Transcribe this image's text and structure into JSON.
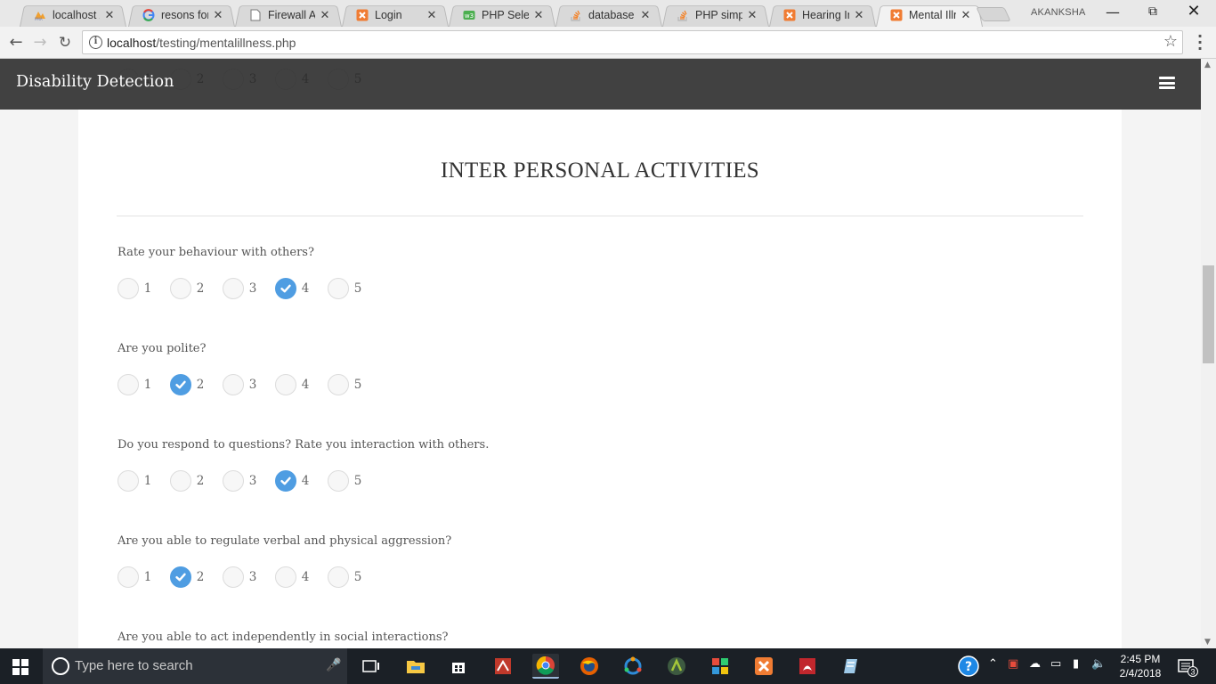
{
  "browser": {
    "tabs": [
      {
        "title": "localhost /",
        "icon": "phpmyadmin-icon",
        "color": "#e8a33d",
        "active": false
      },
      {
        "title": "resons for l",
        "icon": "google-icon",
        "color": "#4285f4",
        "active": false
      },
      {
        "title": "Firewall Aut",
        "icon": "document-icon",
        "color": "#777777",
        "active": false
      },
      {
        "title": "Login",
        "icon": "xampp-icon",
        "color": "#f07c33",
        "active": false
      },
      {
        "title": "PHP Select",
        "icon": "w3schools-icon",
        "color": "#4caf50",
        "active": false
      },
      {
        "title": "database -",
        "icon": "stackoverflow-icon",
        "color": "#f48024",
        "active": false
      },
      {
        "title": "PHP simple",
        "icon": "stackoverflow-icon",
        "color": "#f48024",
        "active": false
      },
      {
        "title": "Hearing Im",
        "icon": "xampp-icon",
        "color": "#f07c33",
        "active": false
      },
      {
        "title": "Mental Illne",
        "icon": "xampp-icon",
        "color": "#f07c33",
        "active": true
      }
    ],
    "profile_name": "AKANKSHA",
    "url_host": "localhost",
    "url_path": "/testing/mentalillness.php"
  },
  "site": {
    "brand": "Disability Detection",
    "accent_color": "#4f9de2"
  },
  "section": {
    "title": "INTER PERSONAL ACTIVITIES"
  },
  "scale": [
    "1",
    "2",
    "3",
    "4",
    "5"
  ],
  "ghost_selected": null,
  "questions": [
    {
      "text": "Rate your behaviour with others?",
      "selected": 4
    },
    {
      "text": "Are you polite?",
      "selected": 2
    },
    {
      "text": "Do you respond to questions? Rate you interaction with others.",
      "selected": 4
    },
    {
      "text": "Are you able to regulate verbal and physical aggression?",
      "selected": 2
    },
    {
      "text": "Are you able to act independently in social interactions?",
      "selected": null
    }
  ],
  "taskbar": {
    "search_placeholder": "Type here to search",
    "time": "2:45 PM",
    "date": "2/4/2018",
    "notification_count": "3"
  }
}
